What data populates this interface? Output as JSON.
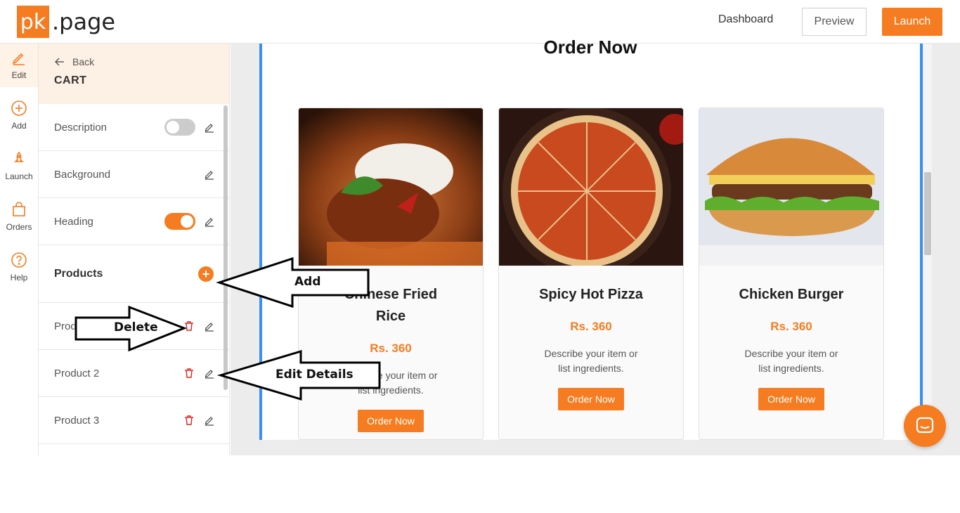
{
  "header": {
    "logo_box": "pk",
    "logo_rest": ".page",
    "dashboard": "Dashboard",
    "preview": "Preview",
    "launch": "Launch"
  },
  "rail": {
    "items": [
      {
        "label": "Edit",
        "icon": "edit-icon"
      },
      {
        "label": "Add",
        "icon": "plus-circle-icon"
      },
      {
        "label": "Launch",
        "icon": "rocket-icon"
      },
      {
        "label": "Orders",
        "icon": "bag-icon"
      },
      {
        "label": "Help",
        "icon": "help-icon"
      }
    ]
  },
  "panel": {
    "back": "Back",
    "title": "CART",
    "rows": [
      {
        "label": "Description",
        "toggle": false
      },
      {
        "label": "Background"
      },
      {
        "label": "Heading",
        "toggle": true
      }
    ],
    "products_label": "Products",
    "add_symbol": "+",
    "products": [
      "Product 1",
      "Product 2",
      "Product 3"
    ]
  },
  "preview": {
    "heading": "Order Now",
    "cards": [
      {
        "title": "Chinese Fried Rice",
        "price": "Rs. 360",
        "desc": "Describe your item or list ingredients.",
        "button": "Order Now"
      },
      {
        "title": "Spicy Hot Pizza",
        "price": "Rs. 360",
        "desc": "Describe your item or list ingredients.",
        "button": "Order Now"
      },
      {
        "title": "Chicken Burger",
        "price": "Rs. 360",
        "desc": "Describe your item or list ingredients.",
        "button": "Order Now"
      }
    ]
  },
  "annotations": {
    "add": "Add",
    "delete": "Delete",
    "edit_details": "Edit Details"
  },
  "colors": {
    "accent": "#f57c20",
    "frame": "#3b8ff3",
    "delete": "#e02424"
  }
}
